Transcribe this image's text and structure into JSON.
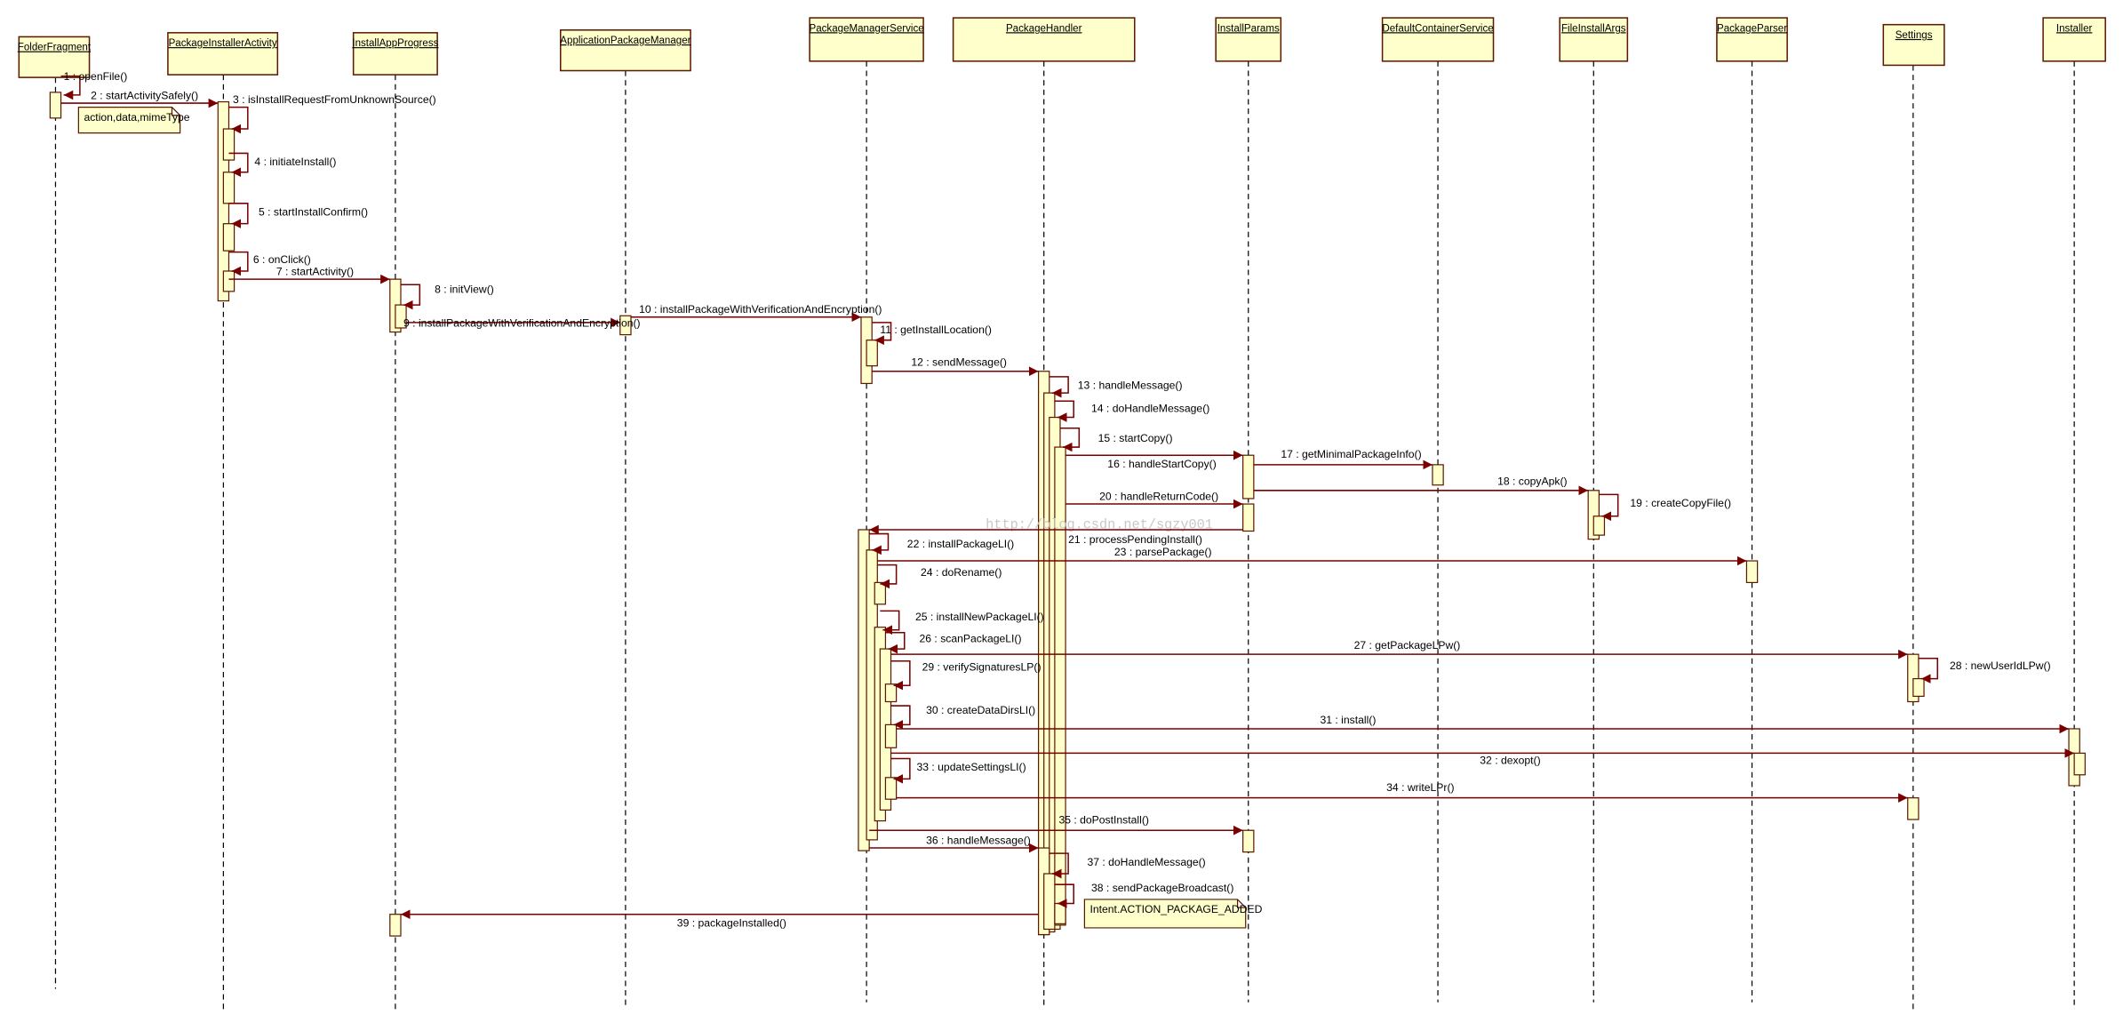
{
  "colors": {
    "box_fill": "#ffffcc",
    "box_stroke": "#5a1a00",
    "message": "#7a0000",
    "lifeline": "#000000"
  },
  "participants": [
    "FolderFragment",
    "PackageInstallerActivity",
    "InstallAppProgress",
    "ApplicationPackageManager",
    "PackageManagerService",
    "PackageHandler",
    "InstallParams",
    "DefaultContainerService",
    "FileInstallArgs",
    "PackageParser",
    "Settings",
    "Installer"
  ],
  "messages": [
    {
      "label": "1 : openFile()",
      "from": "FolderFragment",
      "to": "FolderFragment"
    },
    {
      "label": "2 : startActivitySafely()",
      "from": "FolderFragment",
      "to": "PackageInstallerActivity"
    },
    {
      "label": "3 : isInstallRequestFromUnknownSource()",
      "from": "PackageInstallerActivity",
      "to": "PackageInstallerActivity"
    },
    {
      "label": "4 : initiateInstall()",
      "from": "PackageInstallerActivity",
      "to": "PackageInstallerActivity"
    },
    {
      "label": "5 : startInstallConfirm()",
      "from": "PackageInstallerActivity",
      "to": "PackageInstallerActivity"
    },
    {
      "label": "6 : onClick()",
      "from": "PackageInstallerActivity",
      "to": "PackageInstallerActivity"
    },
    {
      "label": "7 : startActivity()",
      "from": "PackageInstallerActivity",
      "to": "InstallAppProgress"
    },
    {
      "label": "8 : initView()",
      "from": "InstallAppProgress",
      "to": "InstallAppProgress"
    },
    {
      "label": "9 : installPackageWithVerificationAndEncryption()",
      "from": "InstallAppProgress",
      "to": "ApplicationPackageManager"
    },
    {
      "label": "10 : installPackageWithVerificationAndEncryption()",
      "from": "ApplicationPackageManager",
      "to": "PackageManagerService"
    },
    {
      "label": "11 : getInstallLocation()",
      "from": "PackageManagerService",
      "to": "PackageManagerService"
    },
    {
      "label": "12 : sendMessage()",
      "from": "PackageManagerService",
      "to": "PackageHandler"
    },
    {
      "label": "13 : handleMessage()",
      "from": "PackageHandler",
      "to": "PackageHandler"
    },
    {
      "label": "14 : doHandleMessage()",
      "from": "PackageHandler",
      "to": "PackageHandler"
    },
    {
      "label": "15 : startCopy()",
      "from": "PackageHandler",
      "to": "PackageHandler"
    },
    {
      "label": "16 : handleStartCopy()",
      "from": "PackageHandler",
      "to": "InstallParams"
    },
    {
      "label": "17 : getMinimalPackageInfo()",
      "from": "InstallParams",
      "to": "DefaultContainerService"
    },
    {
      "label": "18 : copyApk()",
      "from": "InstallParams",
      "to": "FileInstallArgs"
    },
    {
      "label": "19 : createCopyFile()",
      "from": "FileInstallArgs",
      "to": "FileInstallArgs"
    },
    {
      "label": "20 : handleReturnCode()",
      "from": "PackageHandler",
      "to": "InstallParams"
    },
    {
      "label": "21 : processPendingInstall()",
      "from": "InstallParams",
      "to": "PackageManagerService"
    },
    {
      "label": "22 : installPackageLI()",
      "from": "PackageManagerService",
      "to": "PackageManagerService"
    },
    {
      "label": "23 : parsePackage()",
      "from": "PackageManagerService",
      "to": "PackageParser"
    },
    {
      "label": "24 : doRename()",
      "from": "PackageManagerService",
      "to": "PackageManagerService"
    },
    {
      "label": "25 : installNewPackageLI()",
      "from": "PackageManagerService",
      "to": "PackageManagerService"
    },
    {
      "label": "26 : scanPackageLI()",
      "from": "PackageManagerService",
      "to": "PackageManagerService"
    },
    {
      "label": "27 : getPackageLPw()",
      "from": "PackageManagerService",
      "to": "Settings"
    },
    {
      "label": "28 : newUserIdLPw()",
      "from": "Settings",
      "to": "Settings"
    },
    {
      "label": "29 : verifySignaturesLP()",
      "from": "PackageManagerService",
      "to": "PackageManagerService"
    },
    {
      "label": "30 : createDataDirsLI()",
      "from": "PackageManagerService",
      "to": "PackageManagerService"
    },
    {
      "label": "31 : install()",
      "from": "PackageManagerService",
      "to": "Installer"
    },
    {
      "label": "32 : dexopt()",
      "from": "PackageManagerService",
      "to": "Installer"
    },
    {
      "label": "33 : updateSettingsLI()",
      "from": "PackageManagerService",
      "to": "PackageManagerService"
    },
    {
      "label": "34 : writeLPr()",
      "from": "PackageManagerService",
      "to": "Settings"
    },
    {
      "label": "35 : doPostInstall()",
      "from": "PackageManagerService",
      "to": "InstallParams"
    },
    {
      "label": "36 : handleMessage()",
      "from": "PackageManagerService",
      "to": "PackageHandler"
    },
    {
      "label": "37 : doHandleMessage()",
      "from": "PackageHandler",
      "to": "PackageHandler"
    },
    {
      "label": "38 : sendPackageBroadcast()",
      "from": "PackageHandler",
      "to": "PackageHandler"
    },
    {
      "label": "39 : packageInstalled()",
      "from": "PackageHandler",
      "to": "InstallAppProgress"
    }
  ],
  "notes": [
    "action,data,mimeType",
    "Intent.ACTION_PACKAGE_ADDED"
  ],
  "watermark": "http://blog.csdn.net/sgzy001"
}
